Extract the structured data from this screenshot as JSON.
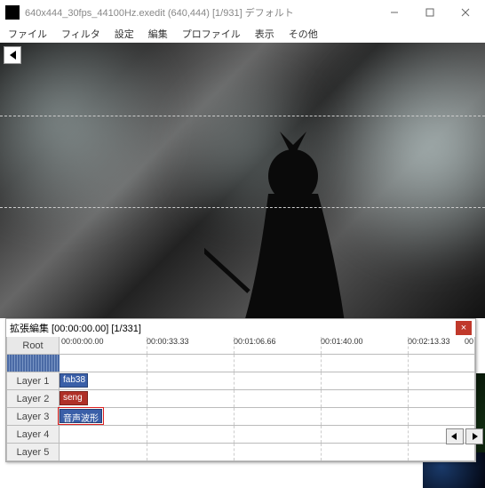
{
  "window": {
    "title": "640x444_30fps_44100Hz.exedit (640,444)  [1/931]  デフォルト"
  },
  "menu": {
    "file": "ファイル",
    "filter": "フィルタ",
    "settings": "設定",
    "edit": "編集",
    "profile": "プロファイル",
    "view": "表示",
    "other": "その他"
  },
  "timeline": {
    "title": "拡張編集 [00:00:00.00] [1/331]",
    "root": "Root",
    "ruler": {
      "t0": "00:00:00.00",
      "t1": "00:00:33.33",
      "t2": "00:01:06.66",
      "t3": "00:01:40.00",
      "t4": "00:02:13.33",
      "t5": "00"
    },
    "layers": {
      "l1": "Layer 1",
      "l2": "Layer 2",
      "l3": "Layer 3",
      "l4": "Layer 4",
      "l5": "Layer 5"
    },
    "clips": {
      "c1": "fab38",
      "c2": "seng",
      "c3": "音声波形"
    }
  }
}
